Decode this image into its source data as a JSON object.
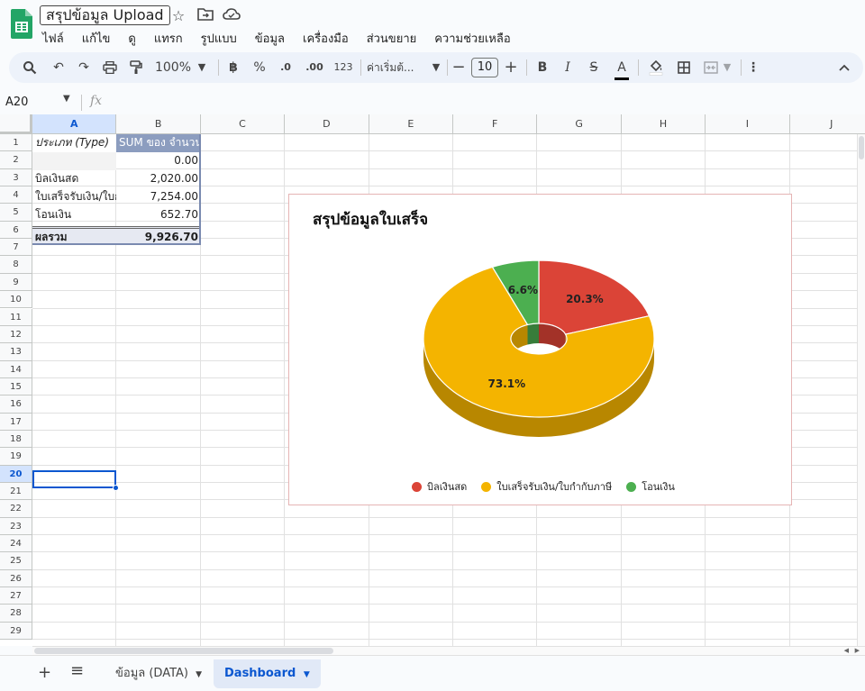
{
  "app": {
    "doc_title": "สรุปข้อมูล Upload",
    "menu": [
      "ไฟล์",
      "แก้ไข",
      "ดู",
      "แทรก",
      "รูปแบบ",
      "ข้อมูล",
      "เครื่องมือ",
      "ส่วนขยาย",
      "ความช่วยเหลือ"
    ]
  },
  "toolbar": {
    "zoom": "100%",
    "currency": "฿",
    "percent": "%",
    "dec_decrease": ".0",
    "dec_increase": ".00",
    "format_123": "123",
    "font": "ค่าเริ่มต้...",
    "font_size": "10",
    "bold": "B",
    "italic": "I",
    "strike": "S",
    "text_color": "A"
  },
  "formula_bar": {
    "cell_ref": "A20",
    "fx": "fx"
  },
  "columns": [
    "A",
    "B",
    "C",
    "D",
    "E",
    "F",
    "G",
    "H",
    "I",
    "J"
  ],
  "rows": [
    "1",
    "2",
    "3",
    "4",
    "5",
    "6",
    "7",
    "8",
    "9",
    "10",
    "11",
    "12",
    "13",
    "14",
    "15",
    "16",
    "17",
    "18",
    "19",
    "20",
    "21",
    "22",
    "23",
    "24",
    "25",
    "26",
    "27",
    "28",
    "29"
  ],
  "pivot": {
    "header_type": "ประเภท (Type)",
    "header_sum": "SUM ของ จำนวน",
    "rows": [
      {
        "label": "",
        "value": "0.00"
      },
      {
        "label": "บิลเงินสด",
        "value": "2,020.00"
      },
      {
        "label": "ใบเสร็จรับเงิน/ใบกำกับภาษี",
        "value": "7,254.00"
      },
      {
        "label": "โอนเงิน",
        "value": "652.70"
      }
    ],
    "total_label": "ผลรวม",
    "total_value": "9,926.70"
  },
  "chart_data": {
    "type": "pie",
    "title": "สรุปข้อมูลใบเสร็จ",
    "style": "3d-donut",
    "legend_position": "bottom",
    "categories": [
      "บิลเงินสด",
      "ใบเสร็จรับเงิน/ใบกำกับภาษี",
      "โอนเงิน"
    ],
    "values": [
      20.3,
      73.1,
      6.6
    ],
    "labels": [
      "20.3%",
      "73.1%",
      "6.6%"
    ],
    "colors": [
      "#db4437",
      "#f4b400",
      "#4caf50"
    ],
    "side_colors": [
      "#a33228",
      "#b88700",
      "#377d3a"
    ]
  },
  "sheets": [
    {
      "name": "ข้อมูล (DATA)",
      "active": false
    },
    {
      "name": "Dashboard",
      "active": true
    }
  ]
}
